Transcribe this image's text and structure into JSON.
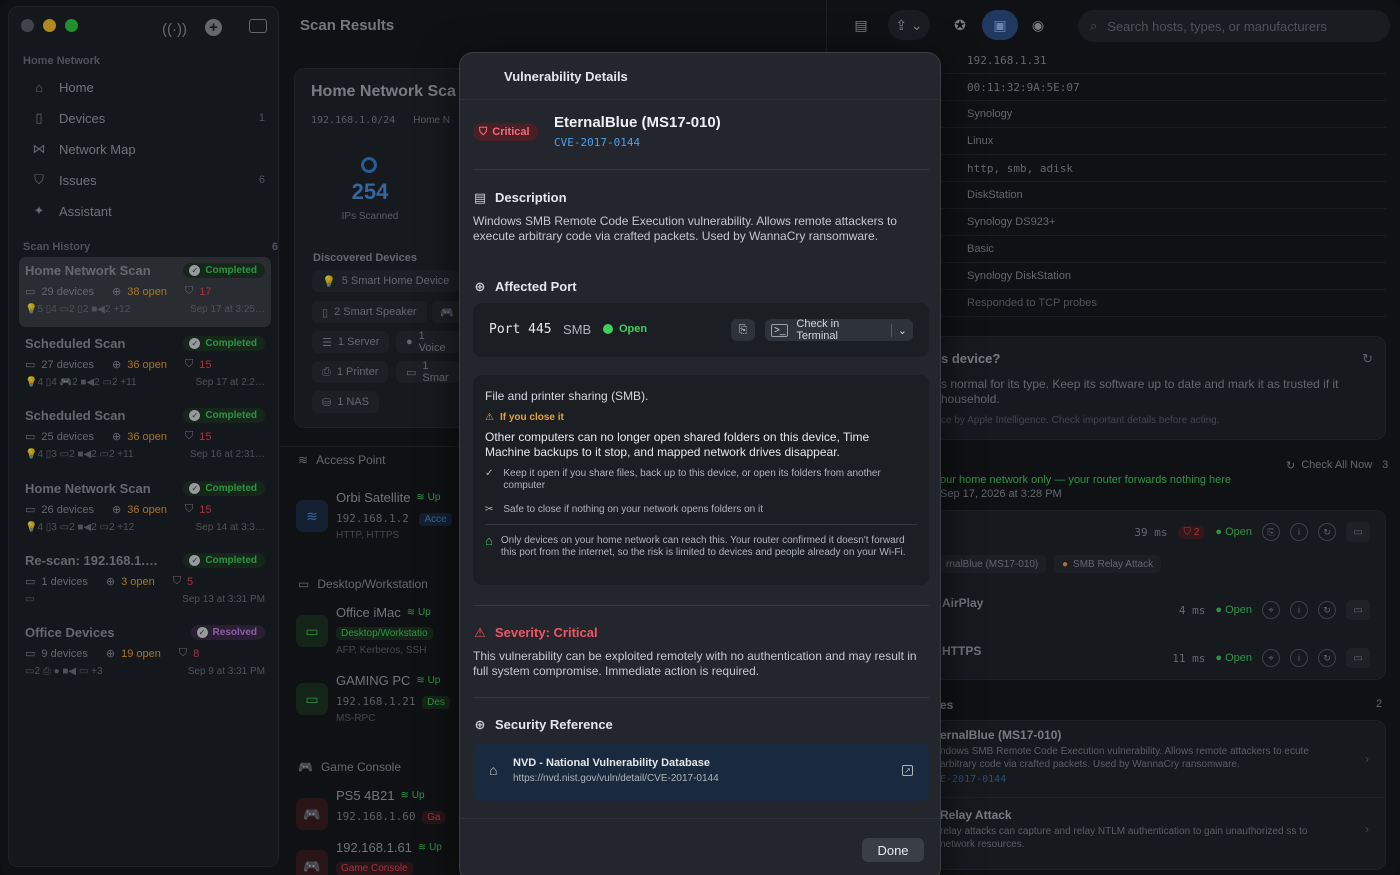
{
  "sidebar": {
    "section_home": "Home Network",
    "nav": [
      {
        "label": "Home",
        "icon": "house-icon",
        "count": ""
      },
      {
        "label": "Devices",
        "icon": "device-icon",
        "count": "1"
      },
      {
        "label": "Network Map",
        "icon": "network-map-icon",
        "count": ""
      },
      {
        "label": "Issues",
        "icon": "shield-icon",
        "count": "6"
      },
      {
        "label": "Assistant",
        "icon": "sparkle-icon",
        "count": ""
      }
    ],
    "section_history": "Scan History",
    "history_count": "6",
    "scans": [
      {
        "name": "Home Network Scan",
        "status": "Completed",
        "devices": "29 devices",
        "open": "38 open",
        "issues": "17",
        "types": "💡5  ▯4  ▭2  ▯2  ■◀2  +12",
        "date": "Sep 17 at 3:25…"
      },
      {
        "name": "Scheduled Scan",
        "status": "Completed",
        "devices": "27 devices",
        "open": "36 open",
        "issues": "15",
        "types": "💡4  ▯4  🎮2  ■◀2  ▭2  +11",
        "date": "Sep 17 at 2:2…"
      },
      {
        "name": "Scheduled Scan",
        "status": "Completed",
        "devices": "25 devices",
        "open": "36 open",
        "issues": "15",
        "types": "💡4  ▯3  ▭2  ■◀2  ▭2  +11",
        "date": "Sep 16 at 2:31…"
      },
      {
        "name": "Home Network Scan",
        "status": "Completed",
        "devices": "26 devices",
        "open": "36 open",
        "issues": "15",
        "types": "💡4  ▯3  ▭2  ■◀2  ▭2  +12",
        "date": "Sep 14 at 3:3…"
      },
      {
        "name": "Re-scan: 192.168.1.…",
        "status": "Completed",
        "devices": "1 devices",
        "open": "3 open",
        "issues": "5",
        "types": "▭",
        "date": "Sep 13 at 3:31 PM"
      },
      {
        "name": "Office Devices",
        "status": "Resolved",
        "devices": "9 devices",
        "open": "19 open",
        "issues": "8",
        "types": "▭2  ⎙  ●  ■◀  ▭  +3",
        "date": "Sep 9 at 3:31 PM"
      }
    ]
  },
  "main": {
    "title": "Scan Results",
    "scan_title": "Home Network Sca",
    "subnet": "192.168.1.0/24",
    "subnet_name": "Home N",
    "ips_scanned": "254",
    "ips_label": "IPs Scanned",
    "discovered_label": "Discovered Devices",
    "chips": [
      "5 Smart Home Device",
      "2 Smart Speaker",
      "1 Server",
      "1 Voice",
      "1 Printer",
      "1 Smar",
      "1 NAS"
    ],
    "groups": {
      "access_point": "Access Point",
      "desktop": "Desktop/Workstation",
      "game_console": "Game Console"
    },
    "devices": [
      {
        "name": "Orbi Satellite",
        "status": "Up",
        "ip": "192.168.1.2",
        "services": "HTTP, HTTPS",
        "tag": "Acce"
      },
      {
        "name": "Office iMac",
        "status": "Up",
        "ip": "",
        "services": "AFP, Kerberos, SSH",
        "tag": "Desktop/Workstatio"
      },
      {
        "name": "GAMING PC",
        "status": "Up",
        "ip": "192.168.1.21",
        "services": "MS-RPC",
        "tag": "Des"
      },
      {
        "name": "PS5 4B21",
        "status": "Up",
        "ip": "192.168.1.60",
        "services": "",
        "tag": "Ga"
      },
      {
        "name": "192.168.1.61",
        "status": "Up",
        "ip": "",
        "services": "",
        "tag": "Game Console"
      }
    ]
  },
  "toolbar": {
    "search_placeholder": "Search hosts, types, or manufacturers"
  },
  "detail": {
    "props": [
      "192.168.1.31",
      "00:11:32:9A:5E:07",
      "Synology",
      "Linux",
      "http, smb, adisk",
      "DiskStation",
      "Synology DS923+",
      "Basic",
      "Synology DiskStation",
      "Responded to TCP probes"
    ],
    "question": "s device?",
    "answer": "s normal for its type. Keep its software up to date and mark it as trusted if it household.",
    "ai_note": "ce by Apple Intelligence. Check important details before acting.",
    "check_all": "Check All Now",
    "check_count": "3",
    "exposure": "our home network only — your router forwards nothing here",
    "exposure_date": "Sep 17, 2026 at 3:28 PM",
    "services": [
      {
        "latency": "39 ms",
        "issues": "2",
        "status": "Open"
      },
      {
        "name": "AirPlay",
        "latency": "4 ms",
        "status": "Open"
      },
      {
        "name": "HTTPS",
        "latency": "11 ms",
        "status": "Open"
      }
    ],
    "tags": [
      "rnalBlue (MS17-010)",
      "SMB Relay Attack"
    ],
    "issues_header": "es",
    "issues_count": "2",
    "issue1_title": "ernalBlue (MS17-010)",
    "issue1_desc": "ndows SMB Remote Code Execution vulnerability. Allows remote attackers to ecute arbitrary code via crafted packets. Used by WannaCry ransomware.",
    "issue1_cve": "E-2017-0144",
    "issue2_title": "Relay Attack",
    "issue2_desc": "relay attacks can capture and relay NTLM authentication to gain unauthorized ss to network resources."
  },
  "modal": {
    "title": "Vulnerability Details",
    "severity_badge": "Critical",
    "name": "EternalBlue (MS17-010)",
    "cve": "CVE-2017-0144",
    "description_header": "Description",
    "description": "Windows SMB Remote Code Execution vulnerability. Allows remote attackers to execute arbitrary code via crafted packets. Used by WannaCry ransomware.",
    "affected_header": "Affected Port",
    "port": "Port 445",
    "protocol": "SMB",
    "port_status": "Open",
    "check_button": "Check in Terminal",
    "port_purpose": "File and printer sharing (SMB).",
    "warn_title": "If you close it",
    "warn_text": "Other computers can no longer open shared folders on this device, Time Machine backups to it stop, and mapped network drives disappear.",
    "keep_text": "Keep it open if you share files, back up to this device, or open its folders from another computer",
    "safe_text": "Safe to close if nothing on your network opens folders on it",
    "home_text": "Only devices on your home network can reach this. Your router confirmed it doesn't forward this port from the internet, so the risk is limited to devices and people already on your Wi-Fi.",
    "severity_header": "Severity: Critical",
    "severity_text": "This vulnerability can be exploited remotely with no authentication and may result in full system compromise. Immediate action is required.",
    "reference_header": "Security Reference",
    "ref_name": "NVD - National Vulnerability Database",
    "ref_url": "https://nvd.nist.gov/vuln/detail/CVE-2017-0144",
    "done": "Done"
  },
  "colors": {
    "critical": "#e2495a",
    "open": "#3ecf5c",
    "accent": "#4aa0f0",
    "warning": "#e8a13a"
  }
}
